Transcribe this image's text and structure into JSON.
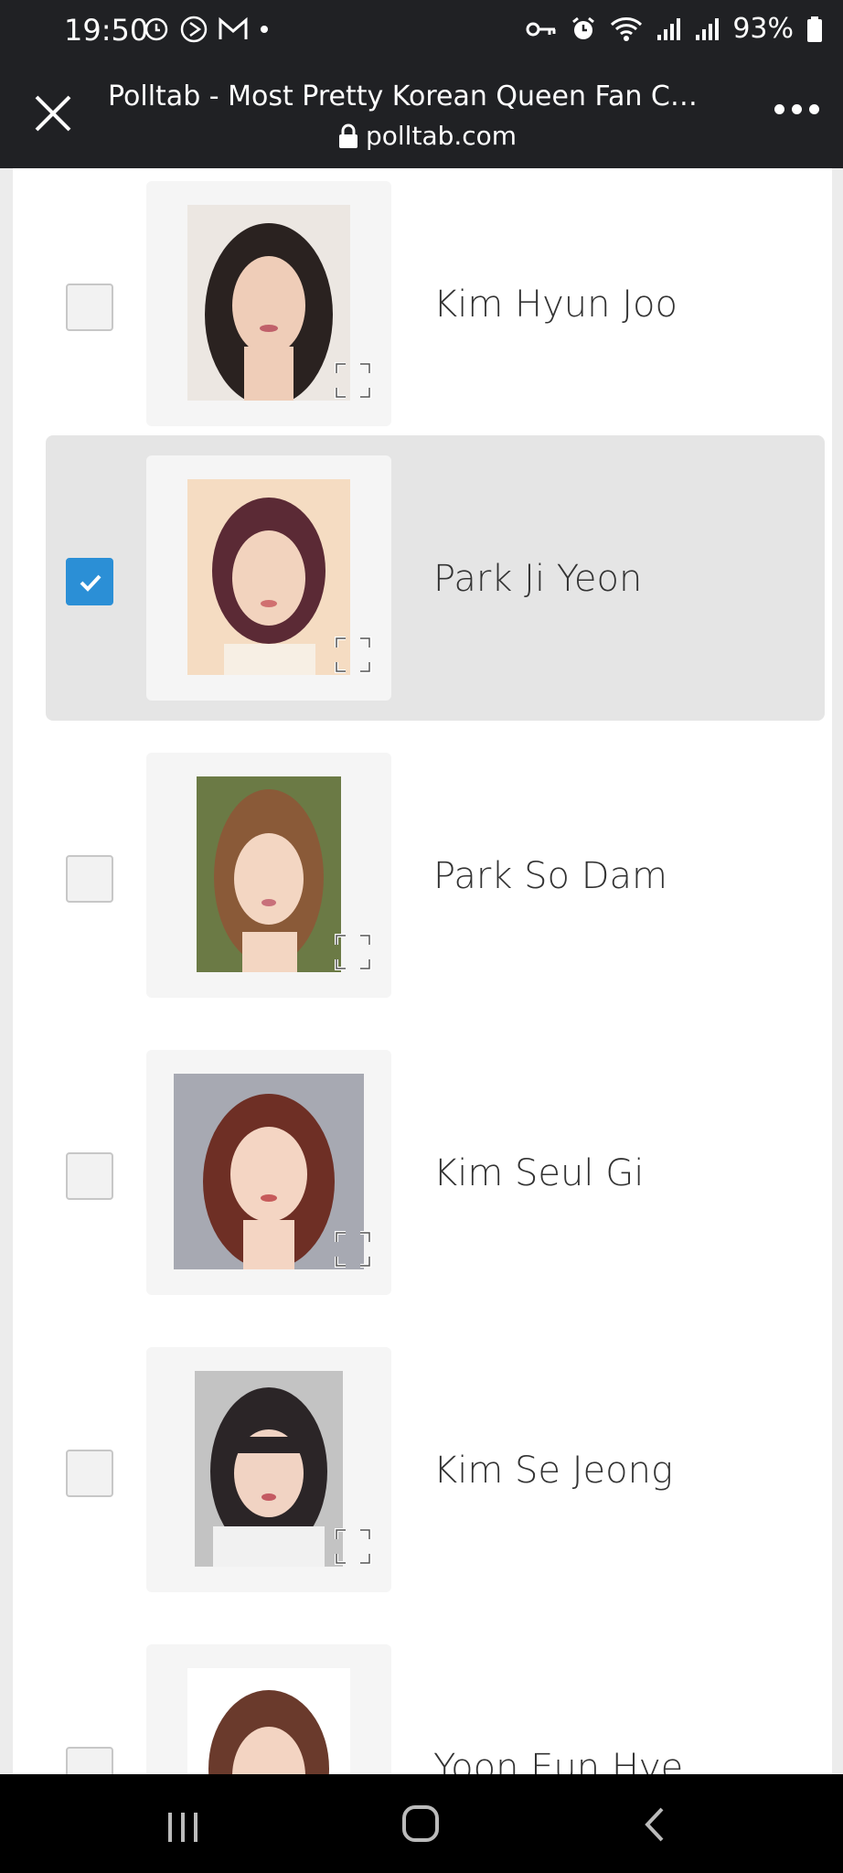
{
  "status": {
    "time": "19:50",
    "battery": "93%"
  },
  "browser": {
    "title": "Polltab - Most Pretty Korean Queen Fan Choice...",
    "url": "polltab.com"
  },
  "poll": {
    "items": [
      {
        "name": "Kim Hyun Joo",
        "checked": false
      },
      {
        "name": "Park Ji Yeon",
        "checked": true
      },
      {
        "name": "Park So Dam",
        "checked": false
      },
      {
        "name": "Kim Seul Gi",
        "checked": false
      },
      {
        "name": "Kim Se Jeong",
        "checked": false
      },
      {
        "name": "Yoon Eun Hye",
        "checked": false
      }
    ]
  },
  "colors": {
    "accent": "#2b8fd6",
    "selected_bg": "#e5e5e5",
    "header_bg": "#202124"
  }
}
